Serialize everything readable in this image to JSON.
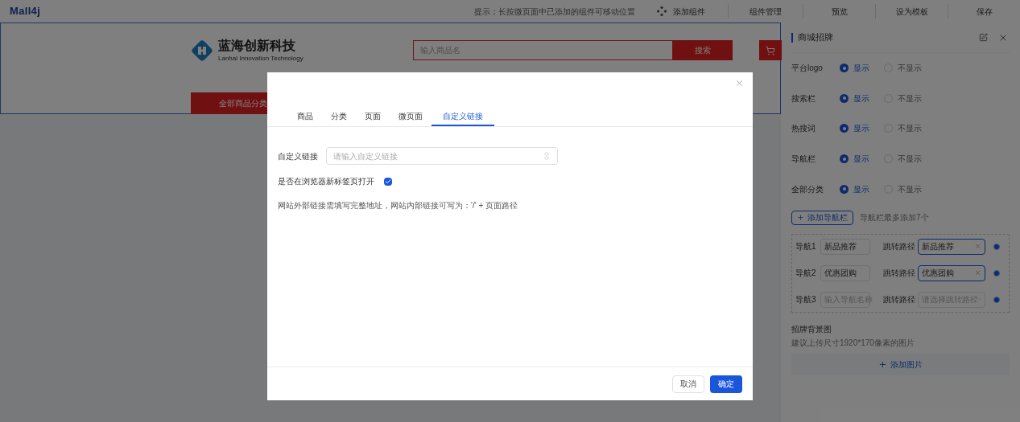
{
  "top_bar": {
    "logo": "Mall4j",
    "tip": "提示：长按微页面中已添加的组件可移动位置",
    "add_component": "添加组件",
    "actions": [
      "组件管理",
      "预览",
      "设为模板",
      "保存"
    ]
  },
  "store_header": {
    "brand_name": "蓝海创新科技",
    "brand_subtitle": "Lanhai Innovation Technology",
    "search_placeholder": "输入商品名",
    "search_button": "搜索",
    "category_button": "全部商品分类"
  },
  "settings_panel": {
    "title": "商城招牌",
    "display_rows": [
      {
        "label": "平台logo",
        "options": [
          {
            "label": "显示",
            "selected": true
          },
          {
            "label": "不显示",
            "selected": false
          }
        ]
      },
      {
        "label": "搜索栏",
        "options": [
          {
            "label": "显示",
            "selected": true
          },
          {
            "label": "不显示",
            "selected": false
          }
        ]
      },
      {
        "label": "热搜词",
        "options": [
          {
            "label": "显示",
            "selected": true
          },
          {
            "label": "不显示",
            "selected": false
          }
        ]
      },
      {
        "label": "导航栏",
        "options": [
          {
            "label": "显示",
            "selected": true
          },
          {
            "label": "不显示",
            "selected": false
          }
        ]
      },
      {
        "label": "全部分类",
        "options": [
          {
            "label": "显示",
            "selected": true
          },
          {
            "label": "不显示",
            "selected": false
          }
        ]
      }
    ],
    "add_nav_button": "添加导航栏",
    "add_nav_hint": "导航栏最多添加7个",
    "nav_items": [
      {
        "label": "导航1",
        "name": {
          "value": "新品推荐"
        },
        "path_label": "跳转路径",
        "path": {
          "value": "新品推荐"
        }
      },
      {
        "label": "导航2",
        "name": {
          "value": "优惠团购"
        },
        "path_label": "跳转路径",
        "path": {
          "value": "优惠团购"
        }
      },
      {
        "label": "导航3",
        "name": {
          "placeholder": "输入导航名称"
        },
        "path_label": "跳转路径",
        "path": {
          "placeholder": "请选择跳转路径"
        }
      }
    ],
    "background_title": "招牌背景图",
    "background_hint": "建议上传尺寸1920*170像素的图片",
    "add_image_button": "添加图片"
  },
  "dialog": {
    "tabs": [
      {
        "label": "商品",
        "selected": false
      },
      {
        "label": "分类",
        "selected": false
      },
      {
        "label": "页面",
        "selected": false
      },
      {
        "label": "微页面",
        "selected": false
      },
      {
        "label": "自定义链接",
        "selected": true
      }
    ],
    "link_label": "自定义链接",
    "link_placeholder": "请输入自定义链接",
    "new_tab_label": "是否在浏览器新标签页打开",
    "new_tab_checked": true,
    "hint": "网站外部链接需填写完整地址，网站内部链接可写为：'/' + 页面路径",
    "buttons": [
      {
        "label": "取消",
        "kind": "secondary"
      },
      {
        "label": "确定",
        "kind": "primary"
      }
    ]
  }
}
